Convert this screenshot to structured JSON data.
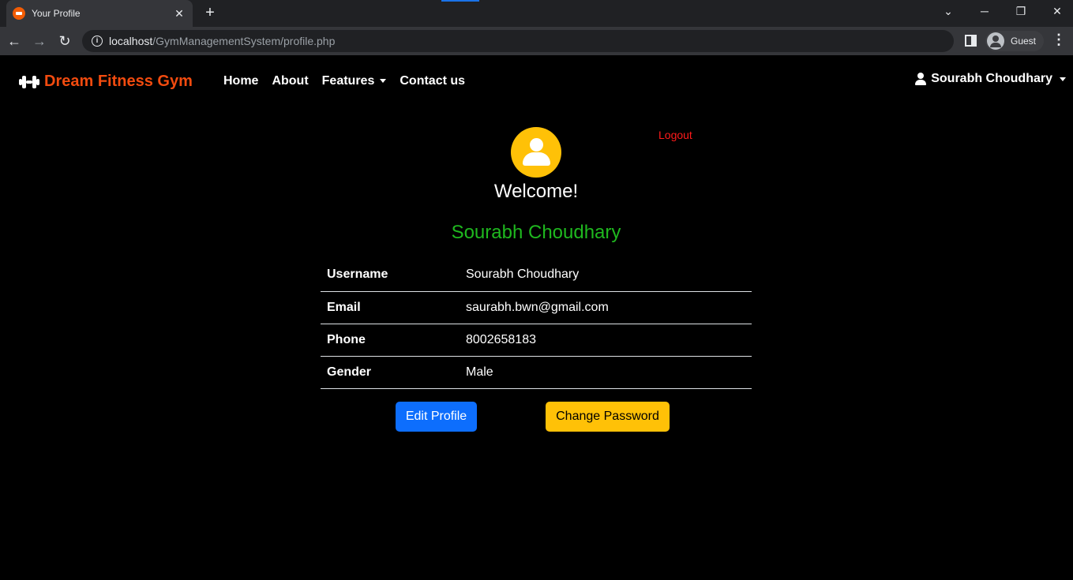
{
  "browser": {
    "tab_title": "Your Profile",
    "tab_close": "✕",
    "new_tab": "+",
    "url_host": "localhost",
    "url_path": "/GymManagementSystem/profile.php",
    "profile_label": "Guest"
  },
  "navbar": {
    "brand": "Dream Fitness Gym",
    "links": [
      {
        "label": "Home"
      },
      {
        "label": "About"
      },
      {
        "label": "Features"
      },
      {
        "label": "Contact us"
      }
    ],
    "user_name": "Sourabh Choudhary"
  },
  "profile": {
    "logout": "Logout",
    "welcome": "Welcome!",
    "full_name": "Sourabh Choudhary",
    "rows": [
      {
        "key": "Username",
        "value": "Sourabh Choudhary"
      },
      {
        "key": "Email",
        "value": "saurabh.bwn@gmail.com"
      },
      {
        "key": "Phone",
        "value": "8002658183"
      },
      {
        "key": "Gender",
        "value": "Male"
      }
    ],
    "edit_button": "Edit Profile",
    "password_button": "Change Password"
  },
  "colors": {
    "brand": "#f24b0f",
    "name_green": "#1fb81f",
    "logout_red": "#ff1a1a",
    "primary": "#0d6efd",
    "warning": "#ffc107"
  }
}
